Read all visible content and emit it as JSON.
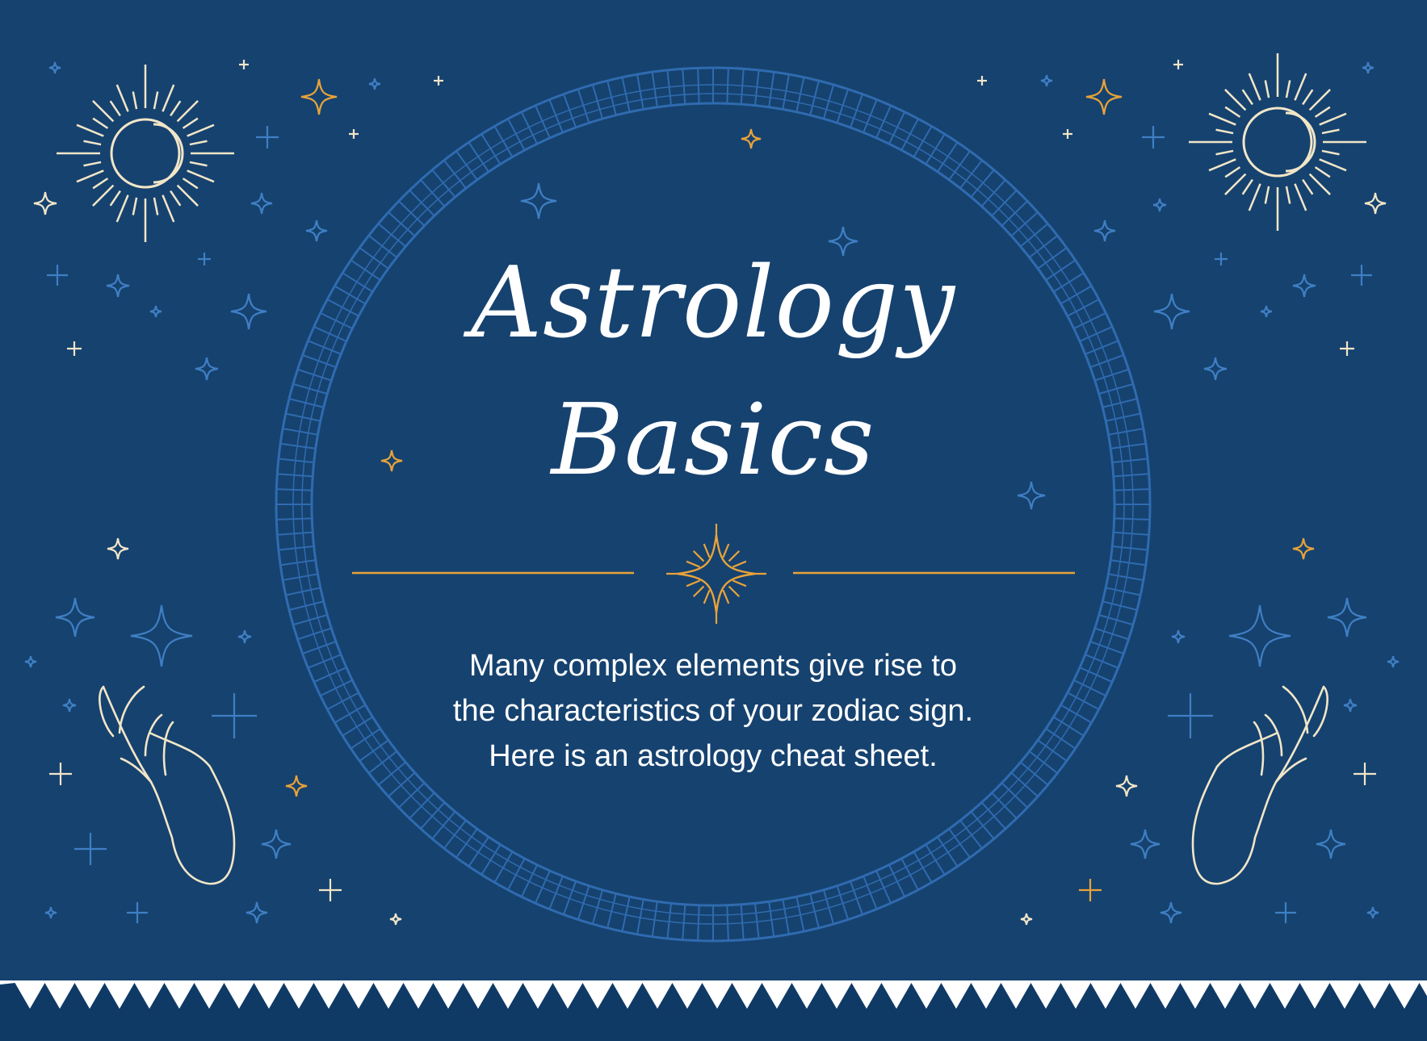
{
  "title": {
    "line1": "Astrology",
    "line2": "Basics"
  },
  "intro": {
    "line1": "Many complex elements give rise to",
    "line2": "the characteristics of your zodiac sign.",
    "line3": "Here is an astrology cheat sheet."
  },
  "colors": {
    "background": "#16426f",
    "ring": "#2f6bb0",
    "star_blue": "#3f7fc4",
    "star_gold": "#e8a33a",
    "line_art": "#f1e6c8",
    "zigzag": "#0f3a66",
    "text": "#ffffff"
  },
  "icons": {
    "sun_left": "sun-moon-icon",
    "sun_right": "sun-moon-icon",
    "hand_left": "hand-icon",
    "hand_right": "hand-icon",
    "center_ornament": "sparkle-star-icon"
  }
}
